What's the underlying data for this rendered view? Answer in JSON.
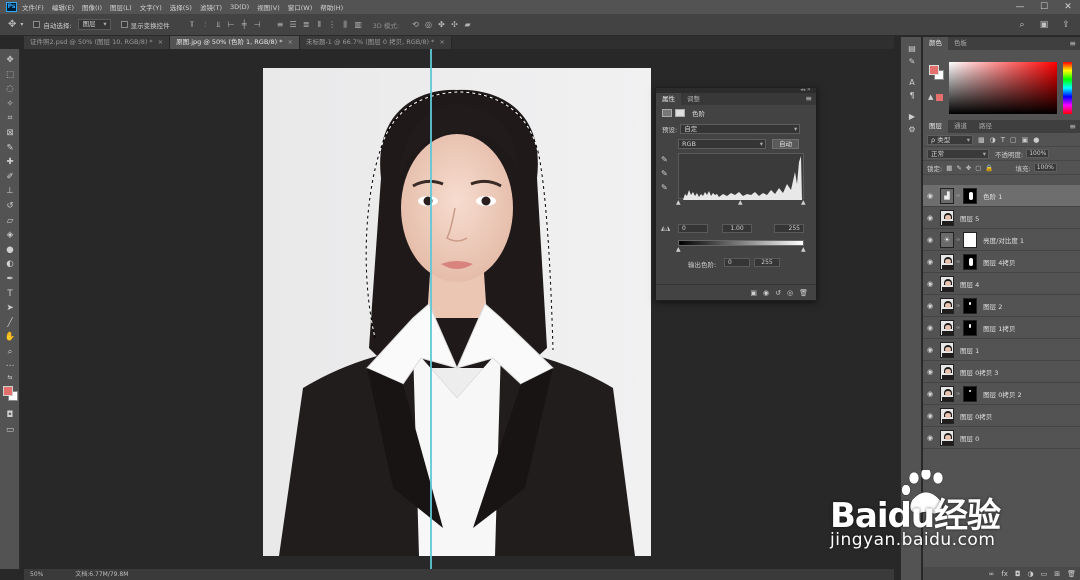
{
  "menu": {
    "app_icon": "Ps",
    "items": [
      "文件(F)",
      "编辑(E)",
      "图像(I)",
      "图层(L)",
      "文字(Y)",
      "选择(S)",
      "滤镜(T)",
      "3D(D)",
      "视图(V)",
      "窗口(W)",
      "帮助(H)"
    ],
    "window_controls": [
      "—",
      "☐",
      "✕"
    ]
  },
  "options": {
    "auto_select_label": "自动选择:",
    "auto_select_value": "图层",
    "show_transform_label": "显示变换控件",
    "mode_3d_label": "3D 模式:"
  },
  "tabs": [
    {
      "label": "证件照2.psd @ 50% (图层 10, RGB/8) *",
      "active": false
    },
    {
      "label": "原图.jpg @ 50% (色阶 1, RGB/8) *",
      "active": true
    },
    {
      "label": "未标题-1 @ 66.7% (图层 0 拷贝, RGB/8) *",
      "active": false
    }
  ],
  "status": {
    "zoom": "50%",
    "doc_info": "文档:6.77M/79.8M"
  },
  "properties": {
    "tabs": [
      "属性",
      "调整"
    ],
    "title": "色阶",
    "preset_label": "预设:",
    "preset_value": "自定",
    "channel_value": "RGB",
    "auto_label": "自动",
    "input_black": "0",
    "input_gamma": "1.00",
    "input_white": "255",
    "output_label": "输出色阶:",
    "output_black": "0",
    "output_white": "255"
  },
  "color_panel": {
    "tabs": [
      "颜色",
      "色板"
    ],
    "foreground": "#e56f6c",
    "background": "#ffffff"
  },
  "layers_panel": {
    "tabs": [
      "图层",
      "通道",
      "路径"
    ],
    "filter_label": "ρ 类型",
    "blend_mode": "正常",
    "opacity_label": "不透明度:",
    "opacity_value": "100%",
    "lock_label": "锁定:",
    "fill_label": "填充:",
    "fill_value": "100%",
    "layers": [
      {
        "name": "色阶 1",
        "type": "adjustment",
        "mask": "black-shape",
        "selected": true
      },
      {
        "name": "图层 5",
        "type": "image",
        "mask": "none",
        "selected": false
      },
      {
        "name": "亮度/对比度 1",
        "type": "adjustment-sun",
        "mask": "white",
        "selected": false
      },
      {
        "name": "图层 4拷贝",
        "type": "image",
        "mask": "black-shape",
        "selected": false
      },
      {
        "name": "图层 4",
        "type": "image",
        "mask": "none",
        "selected": false
      },
      {
        "name": "图层 2",
        "type": "image",
        "mask": "black-shape",
        "selected": false
      },
      {
        "name": "图层 1拷贝",
        "type": "image",
        "mask": "black-shape",
        "selected": false
      },
      {
        "name": "图层 1",
        "type": "image",
        "mask": "none",
        "selected": false
      },
      {
        "name": "图层 0拷贝 3",
        "type": "image",
        "mask": "none",
        "selected": false
      },
      {
        "name": "图层 0拷贝 2",
        "type": "image",
        "mask": "black-shape",
        "selected": false
      },
      {
        "name": "图层 0拷贝",
        "type": "image",
        "mask": "none",
        "selected": false
      },
      {
        "name": "图层 0",
        "type": "image",
        "mask": "none",
        "selected": false
      }
    ]
  },
  "watermark": {
    "logo": "Baidu经验",
    "url": "jingyan.baidu.com"
  }
}
